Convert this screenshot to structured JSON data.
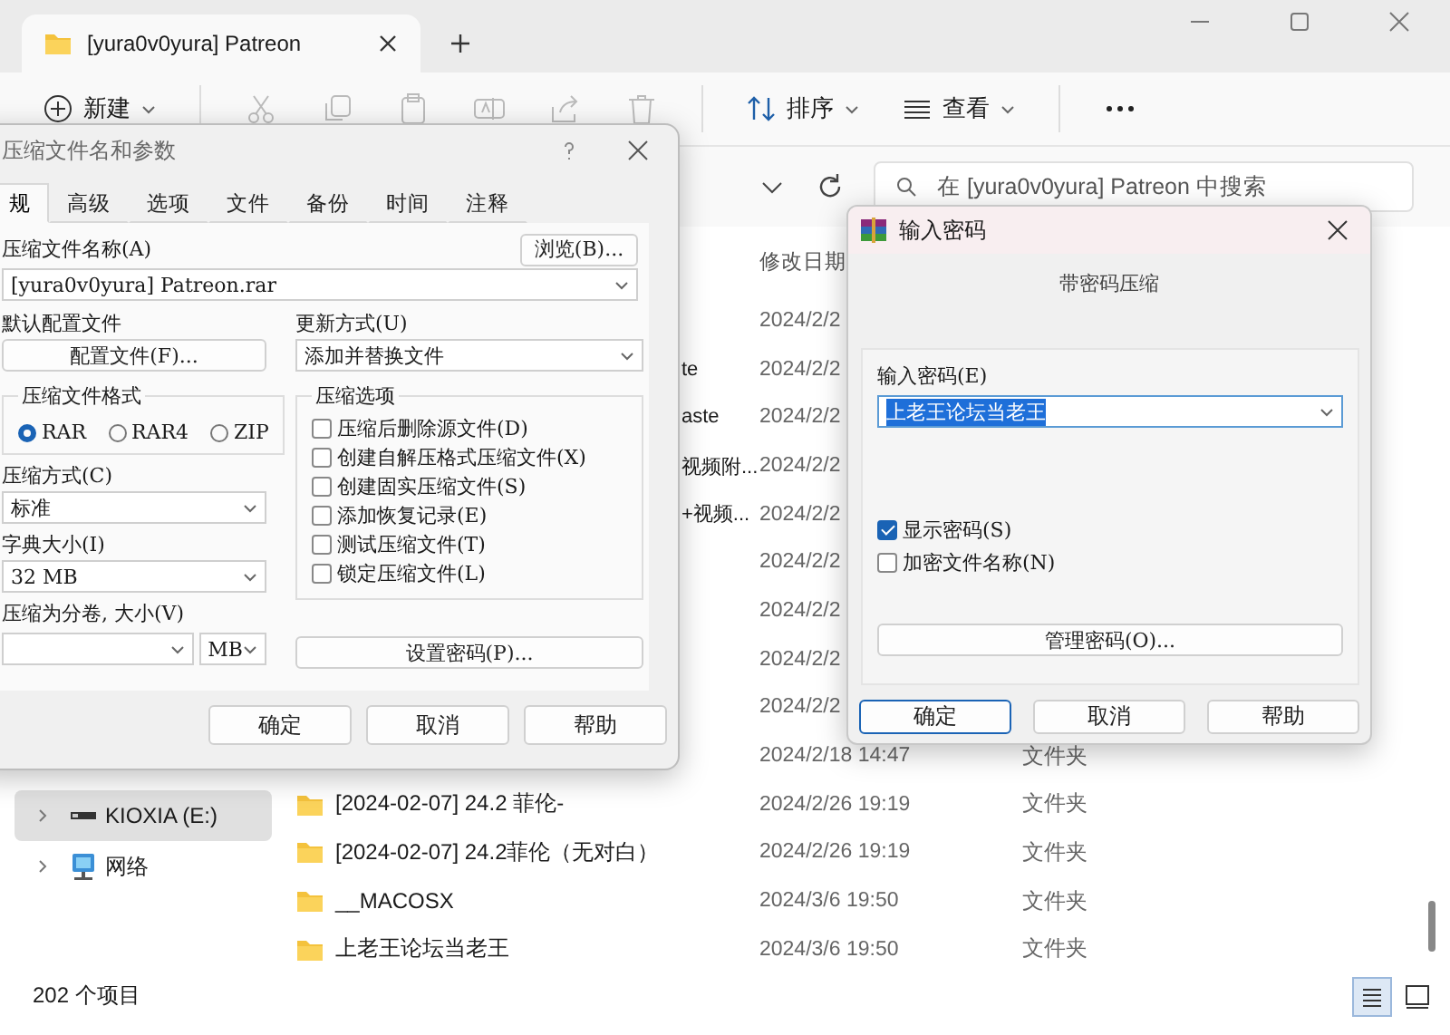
{
  "explorer": {
    "tab": {
      "title": "[yura0v0yura] Patreon"
    },
    "toolbar": {
      "new_label": "新建",
      "sort_label": "排序",
      "view_label": "查看"
    },
    "search": {
      "placeholder": "在 [yura0v0yura] Patreon 中搜索"
    },
    "nav_items": [
      {
        "kind": "drive",
        "label": "KIOXIA (E:)",
        "selected": true
      },
      {
        "kind": "network",
        "label": "网络",
        "selected": false
      }
    ],
    "date_header": "修改日期",
    "rows": [
      {
        "kind": "hidden",
        "date": "2024/2/2"
      },
      {
        "kind": "partial",
        "name": "te",
        "date": "2024/2/2"
      },
      {
        "kind": "partial",
        "name": "aste",
        "date": "2024/2/2"
      },
      {
        "kind": "partial",
        "name": "视频附...",
        "date": "2024/2/2"
      },
      {
        "kind": "partial",
        "name": "+视频...",
        "date": "2024/2/2"
      },
      {
        "kind": "hidden",
        "date": "2024/2/2"
      },
      {
        "kind": "hidden",
        "date": "2024/2/2"
      },
      {
        "kind": "hidden",
        "date": "2024/2/2"
      },
      {
        "kind": "hidden",
        "date": "2024/2/2"
      },
      {
        "kind": "hidden",
        "date": "2024/2/18 14:47",
        "type": "文件夹"
      },
      {
        "kind": "folder",
        "name": "[2024-02-07] 24.2  菲伦-",
        "date": "2024/2/26 19:19",
        "type": "文件夹"
      },
      {
        "kind": "folder",
        "name": "[2024-02-07] 24.2菲伦（无对白）",
        "date": "2024/2/26 19:19",
        "type": "文件夹"
      },
      {
        "kind": "folder",
        "name": "__MACOSX",
        "date": "2024/3/6 19:50",
        "type": "文件夹"
      },
      {
        "kind": "folder",
        "name": "上老王论坛当老王",
        "date": "2024/3/6 19:50",
        "type": "文件夹"
      }
    ],
    "status": "202 个项目"
  },
  "archive_dialog": {
    "title": "压缩文件名和参数",
    "tabs": [
      {
        "label": "规",
        "selected": true
      },
      {
        "label": "高级",
        "selected": false
      },
      {
        "label": "选项",
        "selected": false
      },
      {
        "label": "文件",
        "selected": false
      },
      {
        "label": "备份",
        "selected": false
      },
      {
        "label": "时间",
        "selected": false
      },
      {
        "label": "注释",
        "selected": false
      }
    ],
    "name_label": "压缩文件名称(A)",
    "browse_button": "浏览(B)...",
    "name_value": "[yura0v0yura] Patreon.rar",
    "profile_label": "默认配置文件",
    "profile_button": "配置文件(F)...",
    "update_label": "更新方式(U)",
    "update_value": "添加并替换文件",
    "format_group": "压缩文件格式",
    "formats": [
      {
        "label": "RAR",
        "selected": true
      },
      {
        "label": "RAR4",
        "selected": false
      },
      {
        "label": "ZIP",
        "selected": false
      }
    ],
    "options_group": "压缩选项",
    "options": [
      {
        "label": "压缩后删除源文件(D)",
        "checked": false
      },
      {
        "label": "创建自解压格式压缩文件(X)",
        "checked": false
      },
      {
        "label": "创建固实压缩文件(S)",
        "checked": false
      },
      {
        "label": "添加恢复记录(E)",
        "checked": false
      },
      {
        "label": "测试压缩文件(T)",
        "checked": false
      },
      {
        "label": "锁定压缩文件(L)",
        "checked": false
      }
    ],
    "method_label": "压缩方式(C)",
    "method_value": "标准",
    "dict_label": "字典大小(I)",
    "dict_value": "32 MB",
    "volume_label": "压缩为分卷, 大小(V)",
    "volume_unit": "MB",
    "password_button": "设置密码(P)...",
    "buttons": [
      "确定",
      "取消",
      "帮助"
    ]
  },
  "password_dialog": {
    "title": "输入密码",
    "subtitle": "带密码压缩",
    "field_label": "输入密码(E)",
    "value": "上老王论坛当老王",
    "value_highlighted": true,
    "checks": [
      {
        "label": "显示密码(S)",
        "checked": true
      },
      {
        "label": "加密文件名称(N)",
        "checked": false
      }
    ],
    "manage_button": "管理密码(O)...",
    "buttons": [
      {
        "label": "确定",
        "default": true
      },
      {
        "label": "取消",
        "default": false
      },
      {
        "label": "帮助",
        "default": false
      }
    ]
  }
}
